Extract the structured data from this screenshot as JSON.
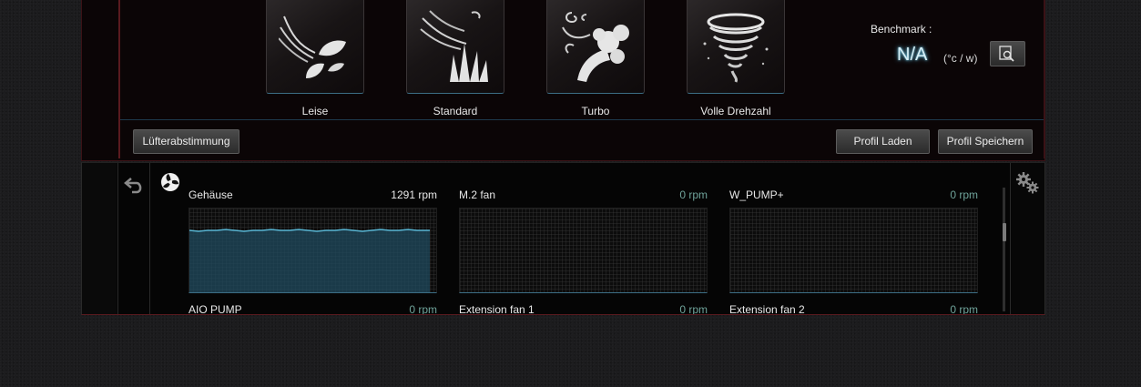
{
  "modes": [
    {
      "label": "Leise",
      "icon": "quiet-leaves-icon"
    },
    {
      "label": "Standard",
      "icon": "standard-grass-icon"
    },
    {
      "label": "Turbo",
      "icon": "turbo-swirl-icon"
    },
    {
      "label": "Volle Drehzahl",
      "icon": "full-speed-tornado-icon"
    }
  ],
  "benchmark": {
    "label": "Benchmark :",
    "value": "N/A",
    "unit": "(°c / w)",
    "button_icon": "benchmark-search-icon"
  },
  "buttons": {
    "fan_tuning": "Lüfterabstimmung",
    "load_profile": "Profil Laden",
    "save_profile": "Profil Speichern"
  },
  "fans": [
    {
      "name": "Gehäuse",
      "rpm": "1291 rpm",
      "level": 0.73,
      "active": true
    },
    {
      "name": "M.2 fan",
      "rpm": "0 rpm",
      "level": 0,
      "active": false
    },
    {
      "name": "W_PUMP+",
      "rpm": "0 rpm",
      "level": 0,
      "active": false
    },
    {
      "name": "AIO PUMP",
      "rpm": "0 rpm",
      "level": 0,
      "active": false
    },
    {
      "name": "Extension fan 1",
      "rpm": "0 rpm",
      "level": 0,
      "active": false
    },
    {
      "name": "Extension fan 2",
      "rpm": "0 rpm",
      "level": 0,
      "active": false
    }
  ],
  "colors": {
    "accent_blue": "#3c6e85",
    "graph_fill": "#1f4a5e",
    "graph_line": "#58b5d3",
    "frame_red": "#5a1a1f"
  }
}
